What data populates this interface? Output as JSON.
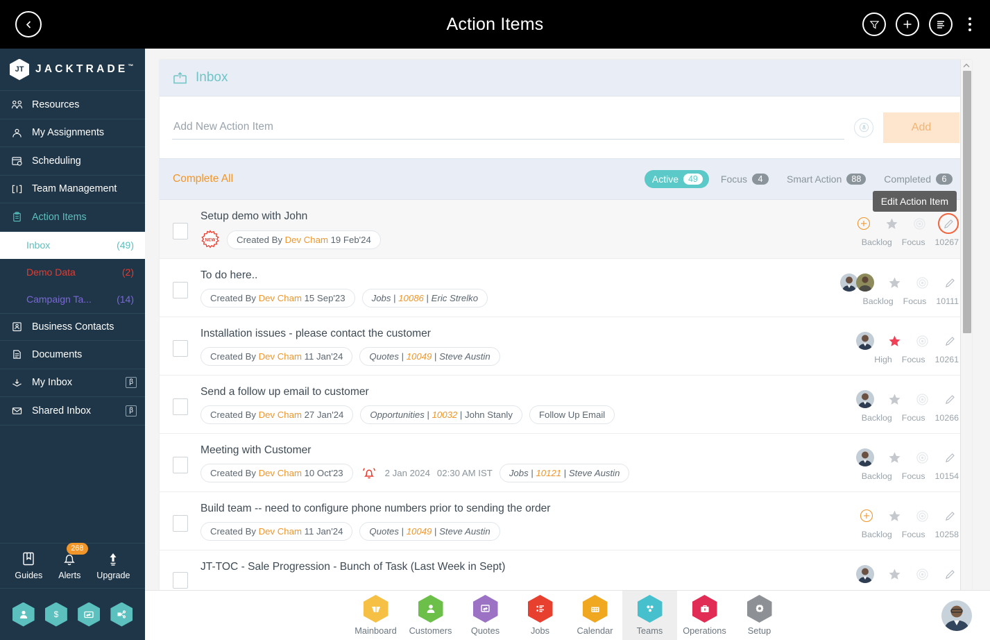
{
  "topbar": {
    "title": "Action Items",
    "back_icon": "chevron-left-icon",
    "actions": [
      {
        "name": "filter-icon",
        "label": "Filter"
      },
      {
        "name": "add-icon",
        "label": "Add"
      },
      {
        "name": "list-view-icon",
        "label": "List View"
      },
      {
        "name": "more-vertical-icon",
        "label": "More"
      }
    ]
  },
  "sidebar": {
    "brand": {
      "mark": "JT",
      "name": "JACKTRADE",
      "tm": "™"
    },
    "items": [
      {
        "label": "Resources",
        "icon": "resources-icon",
        "active": false
      },
      {
        "label": "My Assignments",
        "icon": "assignments-icon",
        "active": false
      },
      {
        "label": "Scheduling",
        "icon": "scheduling-icon",
        "active": false
      },
      {
        "label": "Team Management",
        "icon": "team-management-icon",
        "active": false
      },
      {
        "label": "Action Items",
        "icon": "action-items-icon",
        "active": true
      },
      {
        "label": "Business Contacts",
        "icon": "contacts-icon",
        "active": false
      },
      {
        "label": "Documents",
        "icon": "documents-icon",
        "active": false
      },
      {
        "label": "My Inbox",
        "icon": "my-inbox-icon",
        "active": false,
        "badge": "β"
      },
      {
        "label": "Shared Inbox",
        "icon": "shared-inbox-icon",
        "active": false,
        "badge": "β"
      }
    ],
    "sub_items": [
      {
        "label": "Inbox",
        "count": "(49)",
        "selected": true
      },
      {
        "label": "Demo Data",
        "count": "(2)",
        "selected": false
      },
      {
        "label": "Campaign Ta...",
        "count": "(14)",
        "selected": false
      }
    ],
    "footer": [
      {
        "label": "Guides",
        "icon": "guides-icon"
      },
      {
        "label": "Alerts",
        "icon": "bell-icon",
        "badge": "268"
      },
      {
        "label": "Upgrade",
        "icon": "upgrade-arrow-icon"
      }
    ],
    "quick_actions": [
      {
        "name": "user-hex-icon"
      },
      {
        "name": "dollar-hex-icon"
      },
      {
        "name": "payment-hex-icon"
      },
      {
        "name": "workflow-hex-icon"
      }
    ]
  },
  "panel": {
    "header": {
      "title": "Inbox",
      "icon": "inbox-arrow-icon"
    },
    "add": {
      "placeholder": "Add New Action Item",
      "value": "",
      "mic_icon": "mic-icon",
      "button_label": "Add"
    },
    "complete_all": "Complete All",
    "tabs": [
      {
        "label": "Active",
        "count": "49",
        "active": true
      },
      {
        "label": "Focus",
        "count": "4",
        "active": false
      },
      {
        "label": "Smart Action",
        "count": "88",
        "active": false
      },
      {
        "label": "Completed",
        "count": "6",
        "active": false
      }
    ],
    "tooltip": "Edit Action Item"
  },
  "rows": [
    {
      "title": "Setup demo with John",
      "new_badge": "NEW",
      "highlight": true,
      "tags": [
        {
          "prefix": "Created By ",
          "actor": "Dev Cham",
          "suffix": " 19 Feb'24"
        }
      ],
      "avatars": 0,
      "plus_icon": true,
      "star": "backlog",
      "star_label": "Backlog",
      "focus_label": "Focus",
      "id": "10267",
      "pencil_highlight": true
    },
    {
      "title": "To do here..",
      "highlight": false,
      "tags": [
        {
          "prefix": "Created By ",
          "actor": "Dev Cham",
          "suffix": " 15 Sep'23"
        },
        {
          "entity": "Jobs",
          "sep": " | ",
          "link": "10086",
          "sep2": " | ",
          "person": "Eric Strelko"
        }
      ],
      "avatars": 2,
      "plus_icon": false,
      "star": "backlog",
      "star_label": "Backlog",
      "focus_label": "Focus",
      "id": "10111",
      "pencil_highlight": false
    },
    {
      "title": "Installation issues - please contact the customer",
      "highlight": false,
      "tags": [
        {
          "prefix": "Created By ",
          "actor": "Dev Cham",
          "suffix": " 11 Jan'24"
        },
        {
          "entity": "Quotes",
          "sep": " | ",
          "link": "10049",
          "sep2": " | ",
          "person": "Steve Austin"
        }
      ],
      "avatars": 1,
      "plus_icon": false,
      "star": "high",
      "star_label": "High",
      "focus_label": "Focus",
      "id": "10261",
      "pencil_highlight": false
    },
    {
      "title": "Send a follow up email to customer",
      "highlight": false,
      "tags": [
        {
          "prefix": "Created By ",
          "actor": "Dev Cham",
          "suffix": " 27 Jan'24"
        },
        {
          "entity": "Opportunities",
          "sep": " | ",
          "link": "10032",
          "sep2": " | ",
          "person": "John Stanly"
        },
        {
          "plain": "Follow Up Email"
        }
      ],
      "avatars": 1,
      "plus_icon": false,
      "star": "backlog",
      "star_label": "Backlog",
      "focus_label": "Focus",
      "id": "10266",
      "pencil_highlight": false
    },
    {
      "title": "Meeting with Customer",
      "highlight": false,
      "tags": [
        {
          "prefix": "Created By ",
          "actor": "Dev Cham",
          "suffix": " 10 Oct'23"
        }
      ],
      "reminder": {
        "icon": "alarm-bell-icon",
        "date": "2 Jan 2024",
        "time": "02:30 AM IST"
      },
      "tags_after": [
        {
          "entity": "Jobs",
          "sep": " | ",
          "link": "10121",
          "sep2": " | ",
          "person": "Steve Austin"
        }
      ],
      "avatars": 1,
      "plus_icon": false,
      "star": "backlog",
      "star_label": "Backlog",
      "focus_label": "Focus",
      "id": "10154",
      "pencil_highlight": false
    },
    {
      "title": "Build team -- need to configure phone numbers prior to sending the order",
      "highlight": false,
      "tags": [
        {
          "prefix": "Created By ",
          "actor": "Dev Cham",
          "suffix": " 11 Jan'24"
        },
        {
          "entity": "Quotes",
          "sep": " | ",
          "link": "10049",
          "sep2": " | ",
          "person": "Steve Austin"
        }
      ],
      "avatars": 0,
      "plus_icon": true,
      "star": "backlog",
      "star_label": "Backlog",
      "focus_label": "Focus",
      "id": "10258",
      "pencil_highlight": false
    },
    {
      "title": "JT-TOC - Sale Progression - Bunch of Task (Last Week in Sept)",
      "highlight": false,
      "tags": [],
      "avatars": 1,
      "plus_icon": false,
      "star": "backlog",
      "star_label": "",
      "focus_label": "",
      "id": "",
      "pencil_highlight": false
    }
  ],
  "bottom_nav": [
    {
      "label": "Mainboard",
      "color": "#f5c043",
      "icon": "mainboard-icon",
      "active": false
    },
    {
      "label": "Customers",
      "color": "#6cc04a",
      "icon": "customers-icon",
      "active": false
    },
    {
      "label": "Quotes",
      "color": "#9b72c4",
      "icon": "quotes-icon",
      "active": false
    },
    {
      "label": "Jobs",
      "color": "#e8402f",
      "icon": "jobs-icon",
      "active": false
    },
    {
      "label": "Calendar",
      "color": "#f1a821",
      "icon": "calendar-icon",
      "active": false
    },
    {
      "label": "Teams",
      "color": "#45c0cc",
      "icon": "teams-icon",
      "active": true
    },
    {
      "label": "Operations",
      "color": "#e12d55",
      "icon": "operations-icon",
      "active": false
    },
    {
      "label": "Setup",
      "color": "#8d9195",
      "icon": "setup-icon",
      "active": false
    }
  ],
  "profile": {
    "name": "profile-avatar"
  },
  "colors": {
    "brand_dark": "#1e3648",
    "teal": "#5bc0be",
    "orange": "#f0962a",
    "red": "#e8392c",
    "header_black": "#000000",
    "panel_blue": "#e9eef6"
  }
}
